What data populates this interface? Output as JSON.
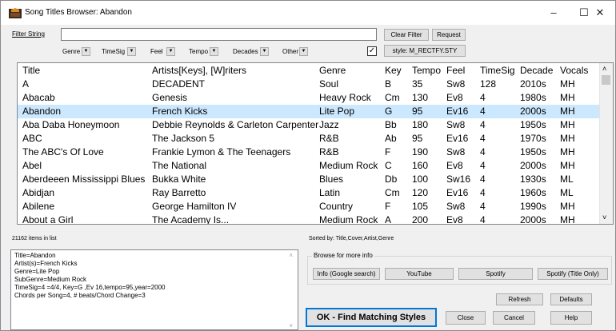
{
  "window": {
    "title": "Song Titles Browser: Abandon",
    "minimize": "–",
    "maximize": "☐",
    "close": "✕"
  },
  "filter": {
    "label": "Filter String",
    "value": "",
    "clear_label": "Clear Filter",
    "request_label": "Request",
    "style_label": "style: M_RECTFY.STY",
    "checkbox_checked": true,
    "dropdowns": [
      "Genre",
      "TimeSig",
      "Feel",
      "Tempo",
      "Decades",
      "Other"
    ]
  },
  "table": {
    "columns": [
      "Title",
      "Artists[Keys], [W]riters",
      "Genre",
      "Key",
      "Tempo",
      "Feel",
      "TimeSig",
      "Decade",
      "Vocals"
    ],
    "selected_index": 2,
    "rows": [
      [
        "A",
        "DECADENT",
        "Soul",
        "B",
        "35",
        "Sw8",
        "128",
        "2010s",
        "MH"
      ],
      [
        "Abacab",
        "Genesis",
        "Heavy Rock",
        "Cm",
        "130",
        "Ev8",
        "4",
        "1980s",
        "MH"
      ],
      [
        "Abandon",
        "French Kicks",
        "Lite Pop",
        "G",
        "95",
        "Ev16",
        "4",
        "2000s",
        "MH"
      ],
      [
        "Aba Daba Honeymoon",
        "Debbie Reynolds & Carleton Carpenter",
        "Jazz",
        "Bb",
        "180",
        "Sw8",
        "4",
        "1950s",
        "MH"
      ],
      [
        "ABC",
        "The Jackson 5",
        "R&B",
        "Ab",
        "95",
        "Ev16",
        "4",
        "1970s",
        "MH"
      ],
      [
        "The ABC's Of Love",
        "Frankie Lymon & The Teenagers",
        "R&B",
        "F",
        "190",
        "Sw8",
        "4",
        "1950s",
        "MH"
      ],
      [
        "Abel",
        "The National",
        "Medium Rock",
        "C",
        "160",
        "Ev8",
        "4",
        "2000s",
        "MH"
      ],
      [
        "Aberdeeen Mississippi Blues",
        "Bukka White",
        "Blues",
        "Db",
        "100",
        "Sw16",
        "4",
        "1930s",
        "ML"
      ],
      [
        "Abidjan",
        "Ray Barretto",
        "Latin",
        "Cm",
        "120",
        "Ev16",
        "4",
        "1960s",
        "ML"
      ],
      [
        "Abilene",
        "George Hamilton IV",
        "Country",
        "F",
        "105",
        "Sw8",
        "4",
        "1990s",
        "MH"
      ],
      [
        "About a Girl",
        "The Academy Is...",
        "Medium Rock",
        "A",
        "200",
        "Ev8",
        "4",
        "2000s",
        "MH"
      ]
    ]
  },
  "status": {
    "count": "21162 items in list",
    "sorted": "Sorted by: Title,Cover,Artist,Genre"
  },
  "info": {
    "lines": [
      "Title=Abandon",
      "Artist(s)=French Kicks",
      "Genre=Lite Pop",
      "SubGenre=Medium Rock",
      "TimeSig=4 =4/4, Key=G  ,Ev 16,tempo=95,year=2000",
      "Chords per Song=4, # beats/Chord Change=3"
    ]
  },
  "browse": {
    "label": "Browse for more info",
    "google": "Info (Google search)",
    "youtube": "YouTube",
    "spotify": "Spotify",
    "spotify_title": "Spotify (Title Only)"
  },
  "actions": {
    "refresh": "Refresh",
    "defaults": "Defaults",
    "ok": "OK - Find Matching Styles",
    "close": "Close",
    "cancel": "Cancel",
    "help": "Help"
  }
}
